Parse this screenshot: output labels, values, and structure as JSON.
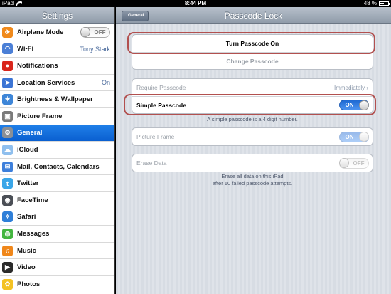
{
  "statusbar": {
    "device": "iPad",
    "time": "8:44 PM",
    "battery": "48 %",
    "battery_level": 0.48
  },
  "sidebar": {
    "title": "Settings",
    "items": [
      {
        "label": "Airplane Mode",
        "icon": "airplane-icon",
        "color": "#f08a1c",
        "toggle": "OFF"
      },
      {
        "label": "Wi-Fi",
        "icon": "wifi-icon",
        "color": "#4b7fd6",
        "value": "Tony Stark"
      },
      {
        "label": "Notifications",
        "icon": "notifications-icon",
        "color": "#d9261c"
      },
      {
        "label": "Location Services",
        "icon": "location-icon",
        "color": "#3b74d4",
        "value": "On"
      },
      {
        "label": "Brightness & Wallpaper",
        "icon": "brightness-icon",
        "color": "#3e86d8"
      },
      {
        "label": "Picture Frame",
        "icon": "picture-frame-icon",
        "color": "#7a7a7a"
      },
      {
        "label": "General",
        "icon": "gear-icon",
        "color": "#8a8f96",
        "selected": true
      },
      {
        "label": "iCloud",
        "icon": "icloud-icon",
        "color": "#8fbfee"
      },
      {
        "label": "Mail, Contacts, Calendars",
        "icon": "mail-icon",
        "color": "#3d7fdb"
      },
      {
        "label": "Twitter",
        "icon": "twitter-icon",
        "color": "#3aa6e8"
      },
      {
        "label": "FaceTime",
        "icon": "facetime-icon",
        "color": "#4b4f56"
      },
      {
        "label": "Safari",
        "icon": "safari-icon",
        "color": "#2f7fd8"
      },
      {
        "label": "Messages",
        "icon": "messages-icon",
        "color": "#43b53f"
      },
      {
        "label": "Music",
        "icon": "music-icon",
        "color": "#f0871a"
      },
      {
        "label": "Video",
        "icon": "video-icon",
        "color": "#2b2b2b"
      },
      {
        "label": "Photos",
        "icon": "photos-icon",
        "color": "#f4c224"
      }
    ]
  },
  "main": {
    "title": "Passcode Lock",
    "back_label": "General",
    "turn_on_label": "Turn Passcode On",
    "change_label": "Change Passcode",
    "require_label": "Require Passcode",
    "require_value": "Immediately",
    "simple_label": "Simple Passcode",
    "simple_toggle": "ON",
    "simple_footer": "A simple passcode is a 4 digit number.",
    "picture_label": "Picture Frame",
    "picture_toggle": "ON",
    "erase_label": "Erase Data",
    "erase_toggle": "OFF",
    "erase_footer_1": "Erase all data on this iPad",
    "erase_footer_2": "after 10 failed passcode attempts."
  }
}
